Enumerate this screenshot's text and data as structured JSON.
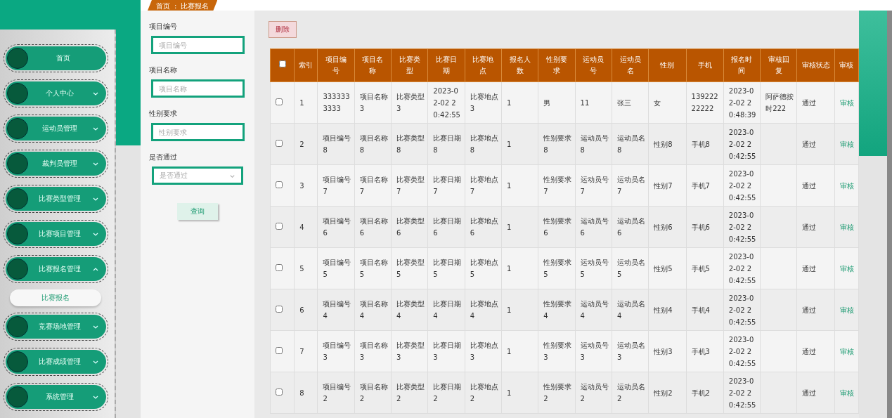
{
  "breadcrumb": {
    "home": "首页",
    "separator": ":",
    "current": "比赛报名"
  },
  "sidebar": {
    "items": [
      {
        "label": "首页"
      },
      {
        "label": "个人中心",
        "expanded": false
      },
      {
        "label": "运动员管理",
        "expanded": false
      },
      {
        "label": "裁判员管理",
        "expanded": false
      },
      {
        "label": "比赛类型管理",
        "expanded": false
      },
      {
        "label": "比赛项目管理",
        "expanded": false
      },
      {
        "label": "比赛报名管理",
        "expanded": true,
        "children": [
          {
            "label": "比赛报名",
            "selected": true
          }
        ]
      },
      {
        "label": "竞赛场地管理",
        "expanded": false
      },
      {
        "label": "比赛成绩管理",
        "expanded": false
      },
      {
        "label": "系统管理",
        "expanded": false
      }
    ]
  },
  "filters": [
    {
      "kind": "input",
      "label": "项目编号",
      "placeholder": "项目编号"
    },
    {
      "kind": "input",
      "label": "项目名称",
      "placeholder": "项目名称"
    },
    {
      "kind": "input",
      "label": "性别要求",
      "placeholder": "性别要求"
    },
    {
      "kind": "select",
      "label": "是否通过",
      "placeholder": "是否通过"
    }
  ],
  "search_button": "查询",
  "delete_button": "删除",
  "table": {
    "select_all_checked": false,
    "columns": [
      "索引",
      "项目编号",
      "项目名称",
      "比赛类型",
      "比赛日期",
      "比赛地点",
      "报名人数",
      "性别要求",
      "运动员号",
      "运动员名",
      "性别",
      "手机",
      "报名时间",
      "审核回复",
      "审核状态",
      "审核"
    ],
    "rows": [
      {
        "checked": false,
        "cells": [
          "1",
          "3333333333",
          "项目名称3",
          "比赛类型3",
          "2023-02-02 20:42:55",
          "比赛地点3",
          "1",
          "男",
          "11",
          "张三",
          "女",
          "13922222222",
          "2023-02-02 20:48:39",
          "阿萨德按时222",
          "通过"
        ],
        "action": "审核"
      },
      {
        "checked": false,
        "cells": [
          "2",
          "项目编号8",
          "项目名称8",
          "比赛类型8",
          "比赛日期8",
          "比赛地点8",
          "1",
          "性别要求8",
          "运动员号8",
          "运动员名8",
          "性别8",
          "手机8",
          "2023-02-02 20:42:55",
          "",
          "通过"
        ],
        "action": "审核"
      },
      {
        "checked": false,
        "cells": [
          "3",
          "项目编号7",
          "项目名称7",
          "比赛类型7",
          "比赛日期7",
          "比赛地点7",
          "1",
          "性别要求7",
          "运动员号7",
          "运动员名7",
          "性别7",
          "手机7",
          "2023-02-02 20:42:55",
          "",
          "通过"
        ],
        "action": "审核"
      },
      {
        "checked": false,
        "cells": [
          "4",
          "项目编号6",
          "项目名称6",
          "比赛类型6",
          "比赛日期6",
          "比赛地点6",
          "1",
          "性别要求6",
          "运动员号6",
          "运动员名6",
          "性别6",
          "手机6",
          "2023-02-02 20:42:55",
          "",
          "通过"
        ],
        "action": "审核"
      },
      {
        "checked": false,
        "cells": [
          "5",
          "项目编号5",
          "项目名称5",
          "比赛类型5",
          "比赛日期5",
          "比赛地点5",
          "1",
          "性别要求5",
          "运动员号5",
          "运动员名5",
          "性别5",
          "手机5",
          "2023-02-02 20:42:55",
          "",
          "通过"
        ],
        "action": "审核"
      },
      {
        "checked": false,
        "cells": [
          "6",
          "项目编号4",
          "项目名称4",
          "比赛类型4",
          "比赛日期4",
          "比赛地点4",
          "1",
          "性别要求4",
          "运动员号4",
          "运动员名4",
          "性别4",
          "手机4",
          "2023-02-02 20:42:55",
          "",
          "通过"
        ],
        "action": "审核"
      },
      {
        "checked": false,
        "cells": [
          "7",
          "项目编号3",
          "项目名称3",
          "比赛类型3",
          "比赛日期3",
          "比赛地点3",
          "1",
          "性别要求3",
          "运动员号3",
          "运动员名3",
          "性别3",
          "手机3",
          "2023-02-02 20:42:55",
          "",
          "通过"
        ],
        "action": "审核"
      },
      {
        "checked": false,
        "cells": [
          "8",
          "项目编号2",
          "项目名称2",
          "比赛类型2",
          "比赛日期2",
          "比赛地点2",
          "1",
          "性别要求2",
          "运动员号2",
          "运动员名2",
          "性别2",
          "手机2",
          "2023-02-02 20:42:55",
          "",
          "通过"
        ],
        "action": "审核"
      }
    ]
  }
}
